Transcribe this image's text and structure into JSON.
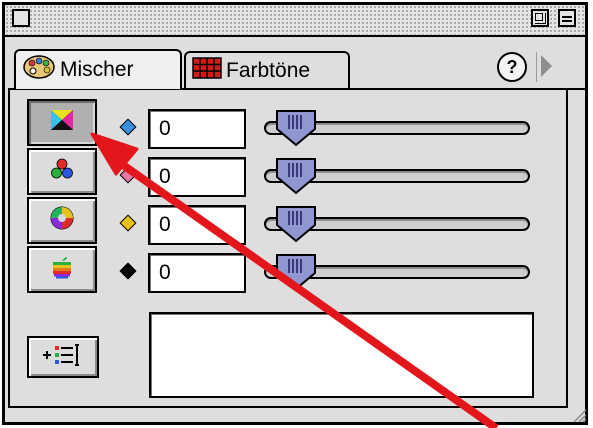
{
  "window": {
    "tabs": [
      {
        "label": "Mischer",
        "icon": "palette-icon",
        "active": true
      },
      {
        "label": "Farbtöne",
        "icon": "color-grid-icon",
        "active": false
      }
    ],
    "help_label": "?"
  },
  "modes": [
    {
      "icon": "cmyk-mode-icon",
      "active": true
    },
    {
      "icon": "rgb-mode-icon",
      "active": false
    },
    {
      "icon": "hsb-wheel-icon",
      "active": false
    },
    {
      "icon": "apple-system-icon",
      "active": false
    }
  ],
  "channels": [
    {
      "value": "0",
      "color": "#3a8fe0",
      "slider": 0
    },
    {
      "value": "0",
      "color": "#e57aa6",
      "slider": 0
    },
    {
      "value": "0",
      "color": "#e9c21b",
      "slider": 0
    },
    {
      "value": "0",
      "color": "#000000",
      "slider": 0
    }
  ],
  "annotation": {
    "arrow_color": "#e3171b"
  }
}
